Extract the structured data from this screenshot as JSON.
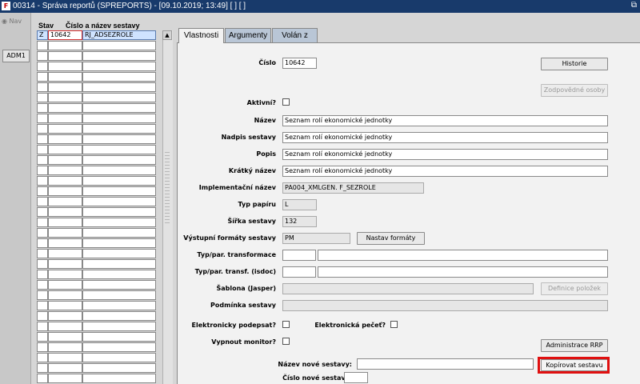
{
  "window": {
    "title": "00314 - Správa reportů (SPREPORTS) - [09.10.2019; 13:49]  [ ]  [ ]",
    "app_icon": "oracle-forms-icon",
    "restore_glyph": "⧉"
  },
  "nav": {
    "tab_label": "Nav",
    "user_button": "ADM1"
  },
  "list": {
    "col_status": "Stav",
    "col_name": "Číslo a název sestavy",
    "rows": [
      {
        "status": "Z",
        "code": "10642",
        "name": "RJ_ADSEZROLE"
      }
    ],
    "empty_rows": 33
  },
  "tabs": [
    {
      "label": "Vlastnosti",
      "active": true
    },
    {
      "label": "Argumenty",
      "active": false
    },
    {
      "label": "Volán z",
      "active": false
    }
  ],
  "form": {
    "cislo": {
      "label": "Číslo",
      "value": "10642"
    },
    "historie_button": "Historie",
    "zodpovedne_button": "Zodpovědné osoby",
    "aktivni": {
      "label": "Aktivní?"
    },
    "nazev": {
      "label": "Název",
      "value": "Seznam rolí ekonomické jednotky"
    },
    "nadpis": {
      "label": "Nadpis sestavy",
      "value": "Seznam rolí ekonomické jednotky"
    },
    "popis": {
      "label": "Popis",
      "value": "Seznam rolí ekonomické jednotky"
    },
    "kratky": {
      "label": "Krátký název",
      "value": "Seznam rolí ekonomické jednotky"
    },
    "implementacni": {
      "label": "Implementační název",
      "value": "PA004_XMLGEN. F_SEZROLE"
    },
    "typ_papiru": {
      "label": "Typ papíru",
      "value": "L"
    },
    "sirka": {
      "label": "Šířka sestavy",
      "value": "132"
    },
    "vystupni": {
      "label": "Výstupní formáty sestavy",
      "value": "PM"
    },
    "nastav_button": "Nastav formáty",
    "typ_transformace": {
      "label": "Typ/par. transformace"
    },
    "typ_transf_isdoc": {
      "label": "Typ/par. transf. (isdoc)"
    },
    "sablona": {
      "label": "Šablona (Jasper)"
    },
    "definice_button": "Definice položek",
    "podminka": {
      "label": "Podmínka sestavy"
    },
    "el_podepsat": {
      "label": "Elektronicky podepsat?"
    },
    "el_pecet": {
      "label": "Elektronická pečeť?"
    },
    "vypnout": {
      "label": "Vypnout monitor?"
    },
    "admin_rrp_button": "Administrace RRP",
    "nazev_nove": {
      "label": "Název nové sestavy:"
    },
    "kopirovat_button": "Kopírovat sestavu",
    "cislo_nove": {
      "label": "Číslo nové sestavy:"
    }
  },
  "colors": {
    "titlebar": "#183a6b",
    "selected_row": "#cfe3ff",
    "highlight": "#e01010",
    "inactive_tab": "#b9c6d6"
  }
}
